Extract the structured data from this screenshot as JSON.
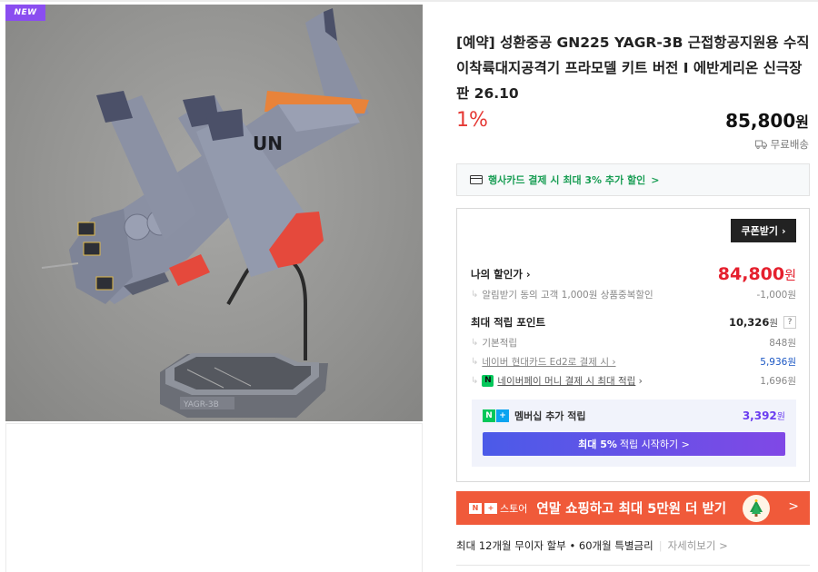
{
  "image": {
    "badge": "NEW",
    "decal_text": "UN",
    "base_text": "YAGR-3B"
  },
  "product": {
    "title": "[예약] 성환중공 GN225 YAGR-3B 근접항공지원용 수직이착륙대지공격기 프라모델 키트 버전 I 에반게리온 신극장판 26.10",
    "discount_rate": "1%",
    "price": "85,800",
    "price_unit": "원",
    "shipping": "무료배송"
  },
  "card_benefit": {
    "label": "행사카드 결제 시 최대 3% 추가 할인",
    "chevron": ">"
  },
  "benefits": {
    "coupon_button": "쿠폰받기",
    "my_price_label": "나의 할인가",
    "my_price": "84,800",
    "my_price_unit": "원",
    "alarm_label": "알림받기 동의 고객 1,000원 상품중복할인",
    "alarm_value": "-1,000원",
    "max_points_label": "최대 적립 포인트",
    "max_points_value": "10,326",
    "max_points_unit": "원",
    "help_icon": "?",
    "basic_label": "기본적립",
    "basic_value": "848원",
    "hyundai_label": "네이버 현대카드 Ed2로 결제 시",
    "hyundai_value": "5,936원",
    "npay_label": "네이버페이 머니 결제 시 최대 적립",
    "npay_value": "1,696원",
    "membership_label": "멤버십 추가 적립",
    "membership_value": "3,392",
    "membership_unit": "원",
    "membership_button_bold": "최대 5%",
    "membership_button_rest": "적립 시작하기 >"
  },
  "promo": {
    "store_label": "스토어",
    "message": "연말 쇼핑하고 최대 5만원 더 받기",
    "arrow": ">"
  },
  "installment": {
    "text": "최대 12개월 무이자 할부 • 60개월 특별금리",
    "more": "자세히보기 >"
  },
  "colors": {
    "accent_red": "#e5202e",
    "green": "#1a9e55",
    "membership_purple": "#6a3df0",
    "promo_orange": "#f05a3a",
    "badge_purple": "#8a4df0"
  }
}
